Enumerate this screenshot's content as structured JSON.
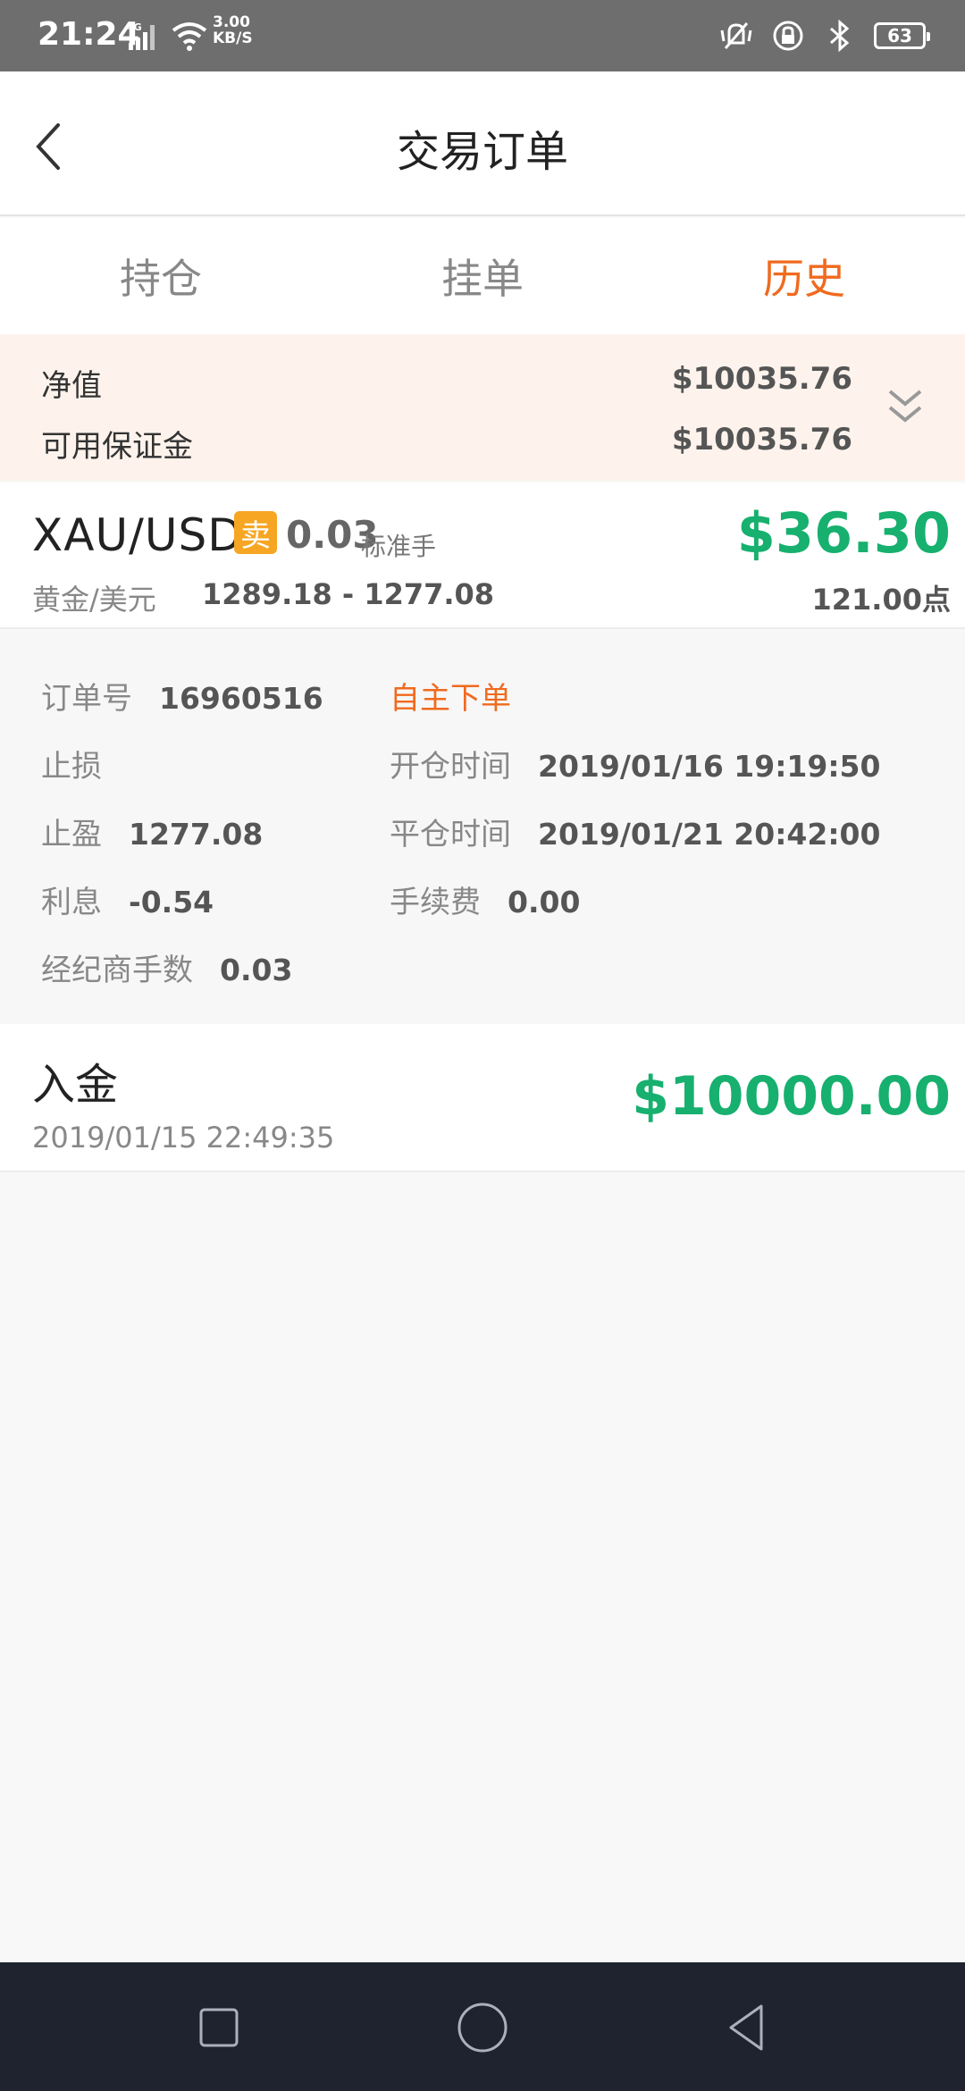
{
  "status_bar": {
    "time": "21:24",
    "network": "4G",
    "speed_value": "3.00",
    "speed_unit": "KB/S",
    "battery": "63"
  },
  "header": {
    "title": "交易订单"
  },
  "tabs": [
    {
      "label": "持仓"
    },
    {
      "label": "挂单"
    },
    {
      "label": "历史"
    }
  ],
  "summary": {
    "equity_label": "净值",
    "equity_value": "$10035.76",
    "margin_label": "可用保证金",
    "margin_value": "$10035.76"
  },
  "order": {
    "symbol": "XAU/USD",
    "side": "卖",
    "lots": "0.03",
    "lots_unit": "标准手",
    "profit": "$36.30",
    "symbol_name": "黄金/美元",
    "price_range": "1289.18 - 1277.08",
    "points": "121.00点",
    "details": {
      "order_no_label": "订单号",
      "order_no": "16960516",
      "order_type": "自主下单",
      "stop_loss_label": "止损",
      "stop_loss": "",
      "open_time_label": "开仓时间",
      "open_time": "2019/01/16 19:19:50",
      "take_profit_label": "止盈",
      "take_profit": "1277.08",
      "close_time_label": "平仓时间",
      "close_time": "2019/01/21 20:42:00",
      "interest_label": "利息",
      "interest": "-0.54",
      "fee_label": "手续费",
      "fee": "0.00",
      "broker_lots_label": "经纪商手数",
      "broker_lots": "0.03"
    }
  },
  "deposit": {
    "title": "入金",
    "date": "2019/01/15 22:49:35",
    "amount": "$10000.00"
  },
  "colors": {
    "accent": "#f06a1e",
    "profit": "#17b06e",
    "sell_badge": "#f6a623"
  }
}
